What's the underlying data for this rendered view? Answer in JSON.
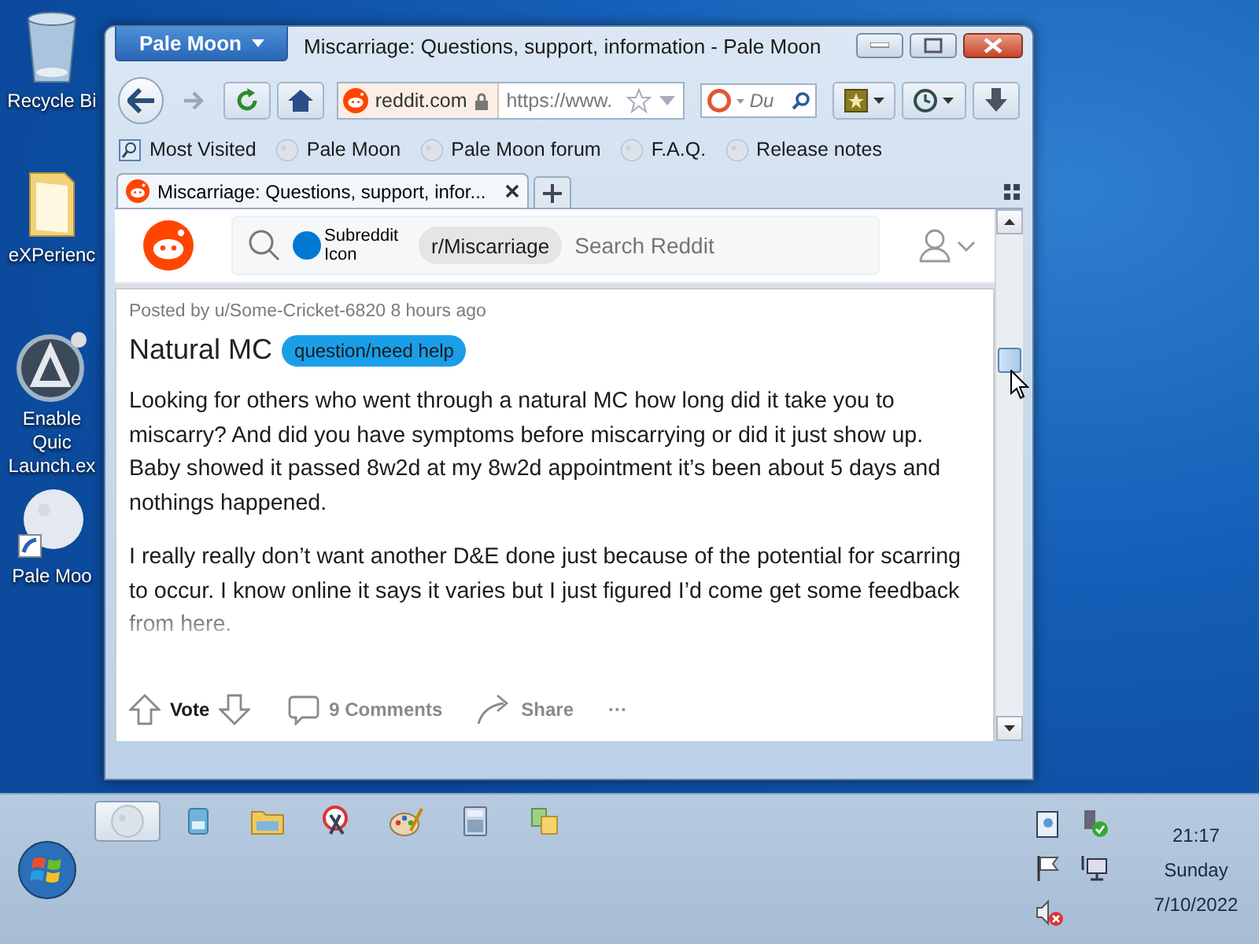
{
  "desktop": {
    "icons": [
      {
        "label": "Recycle Bi",
        "kind": "bin"
      },
      {
        "label": "eXPerienc",
        "kind": "folder"
      },
      {
        "label": "Enable Quic Launch.ex",
        "kind": "app"
      },
      {
        "label": "Pale Moo",
        "kind": "moon"
      }
    ]
  },
  "window": {
    "app_menu": "Pale Moon",
    "title": "Miscarriage: Questions, support, information - Pale Moon"
  },
  "toolbar": {
    "site_identity": "reddit.com",
    "url": "https://www.",
    "search_placeholder": "Du"
  },
  "bookmarks": [
    "Most Visited",
    "Pale Moon",
    "Pale Moon forum",
    "F.A.Q.",
    "Release notes"
  ],
  "tabs": [
    {
      "label": "Miscarriage: Questions, support, infor...",
      "selected": true
    }
  ],
  "page": {
    "subreddit": "r/Miscarriage",
    "subreddit_icon_alt": "Subreddit Icon",
    "search_placeholder": "Search Reddit",
    "post": {
      "byline": "Posted by u/Some-Cricket-6820 8 hours ago",
      "title": "Natural MC",
      "flair": "question/need help",
      "paragraphs": [
        "Looking for others who went through a natural MC how long did it take you to miscarry? And did you have symptoms before miscarrying or did it just show up. Baby showed it passed 8w2d at my 8w2d appointment it’s been about 5 days and nothings happened.",
        "I really really don’t want another D&E done just because of the potential for scarring to occur. I know online it says it varies but I just figured I’d come get some feedback from here."
      ],
      "vote_label": "Vote",
      "comments": "9 Comments",
      "share": "Share",
      "more": "···"
    }
  },
  "taskbar": {
    "items": [
      {
        "kind": "moon",
        "selected": true
      },
      {
        "kind": "media",
        "selected": false
      },
      {
        "kind": "explorer",
        "selected": false
      },
      {
        "kind": "snip",
        "selected": false
      },
      {
        "kind": "paint",
        "selected": false
      },
      {
        "kind": "calc",
        "selected": false
      },
      {
        "kind": "copy",
        "selected": false
      }
    ],
    "clock": {
      "time": "21:17",
      "day": "Sunday",
      "date": "7/10/2022"
    }
  }
}
